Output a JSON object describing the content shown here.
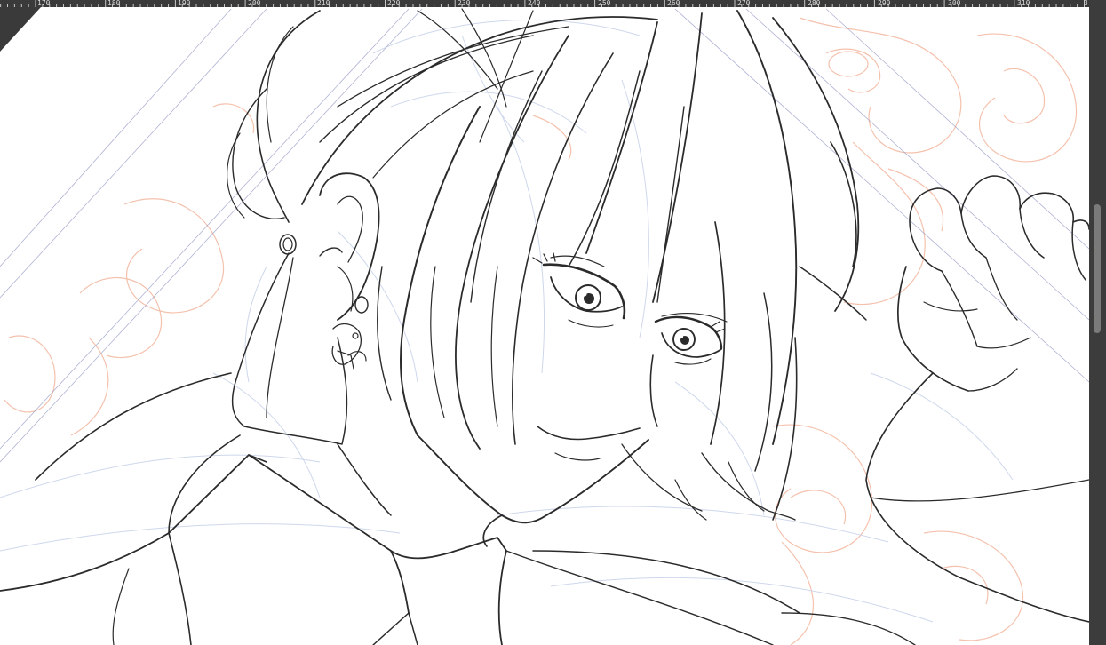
{
  "ruler": {
    "labels": [
      "170",
      "180",
      "190",
      "200",
      "210",
      "220",
      "230",
      "240",
      "250",
      "260",
      "270",
      "280",
      "290",
      "300",
      "310",
      "3"
    ]
  },
  "canvas": {
    "layers": [
      "lineart",
      "color-rough-sketch",
      "blue-rough-sketch"
    ]
  },
  "colors": {
    "workspace": "#3a3a3a",
    "ruler_text": "#d8d8d8",
    "lineart": "#2b2b2b",
    "rough_orange": "#f3b79f",
    "rough_blue": "#c9d3ea",
    "guide": "#9aa0c8"
  },
  "icons": {
    "corner": "canvas-corner-triangle"
  }
}
